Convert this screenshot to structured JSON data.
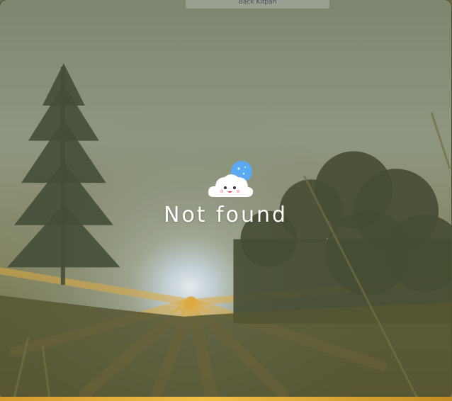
{
  "topbar": {
    "label": "Back Kitpan"
  },
  "empty_state": {
    "mascot_icon": "cloud-moon-face-icon",
    "message": "Not found"
  },
  "colors": {
    "moon": "#5aa9f2",
    "cloud": "#ffffff",
    "sun_rays": "#f3b338"
  }
}
